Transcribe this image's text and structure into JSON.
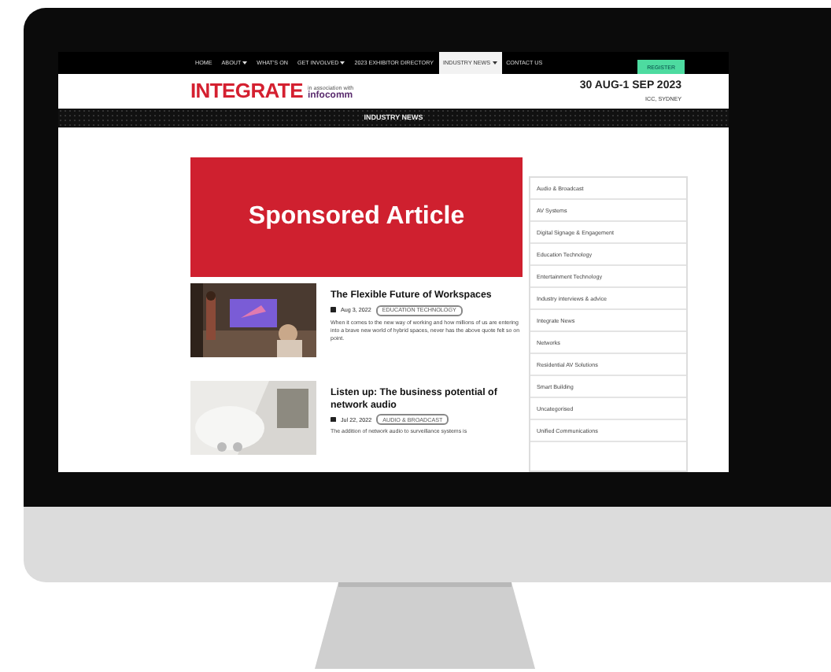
{
  "nav": {
    "items": [
      {
        "label": "HOME",
        "has_menu": false,
        "selected": false
      },
      {
        "label": "ABOUT",
        "has_menu": true,
        "selected": false
      },
      {
        "label": "WHAT'S ON",
        "has_menu": false,
        "selected": false
      },
      {
        "label": "GET INVOLVED",
        "has_menu": true,
        "selected": false
      },
      {
        "label": "2023 EXHIBITOR DIRECTORY",
        "has_menu": false,
        "selected": false
      },
      {
        "label": "INDUSTRY NEWS",
        "has_menu": true,
        "selected": true
      },
      {
        "label": "CONTACT US",
        "has_menu": false,
        "selected": false
      }
    ],
    "button": "REGISTER"
  },
  "header": {
    "logo": "INTEGRATE",
    "partner_note": "in association with",
    "partner": "infocomm",
    "dates": "30 AUG-1 SEP 2023",
    "venue": "ICC, SYDNEY"
  },
  "banner": "INDUSTRY NEWS",
  "sponsored": "Sponsored Article",
  "articles": [
    {
      "title": "The Flexible Future of Workspaces",
      "date": "Aug 3, 2022",
      "tag": "EDUCATION TECHNOLOGY",
      "excerpt": "When it comes to the new way of working and how millions of us are entering into a brave new world of hybrid spaces, never has the above quote felt so on point."
    },
    {
      "title": "Listen up: The business potential of network audio",
      "date": "Jul 22, 2022",
      "tag": "AUDIO & BROADCAST",
      "excerpt": "The addition of network audio to surveillance systems is"
    }
  ],
  "categories": [
    "Audio & Broadcast",
    "AV Systems",
    "Digital Signage & Engagement",
    "Education Technology",
    "Entertainment Technology",
    "Industry interviews & advice",
    "Integrate News",
    "Networks",
    "Residential AV Solutions",
    "Smart Building",
    "Uncategorised",
    "Unified Communications"
  ]
}
